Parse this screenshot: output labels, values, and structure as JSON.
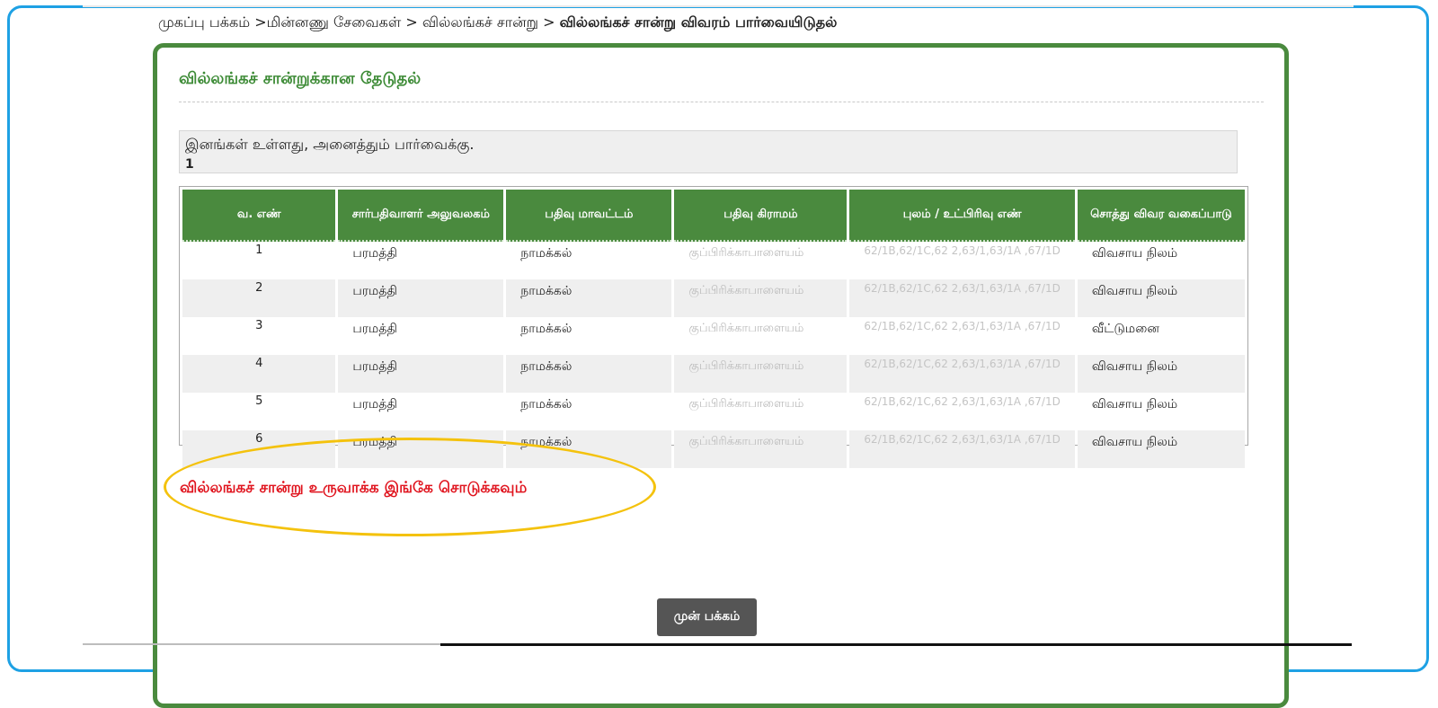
{
  "breadcrumb": {
    "home": "முகப்பு பக்கம்",
    "services": "மின்னணு சேவைகள்",
    "ec": "வில்லங்கச் சான்று",
    "current": "வில்லங்கச் சான்று விவரம் பார்வையிடுதல்",
    "separator": ">"
  },
  "panel": {
    "title": "வில்லங்கச் சான்றுக்கான தேடுதல்"
  },
  "result": {
    "message": "இனங்கள் உள்ளது, அனைத்தும் பார்வைக்கு.",
    "count": "1"
  },
  "table": {
    "headers": [
      "வ. எண்",
      "சார்பதிவாளர் அலுவலகம்",
      "பதிவு மாவட்டம்",
      "பதிவு கிராமம்",
      "புலம் / உட்பிரிவு எண்",
      "சொத்து விவர வகைப்பாடு"
    ],
    "rows": [
      {
        "sno": "1",
        "office": "பரமத்தி",
        "district": "நாமக்கல்",
        "village": "குப்பிரிக்காபாளையம்",
        "survey": "62/1B,62/1C,62 2,63/1,63/1A ,67/1D",
        "type": "விவசாய நிலம்"
      },
      {
        "sno": "2",
        "office": "பரமத்தி",
        "district": "நாமக்கல்",
        "village": "குப்பிரிக்காபாளையம்",
        "survey": "62/1B,62/1C,62 2,63/1,63/1A ,67/1D",
        "type": "விவசாய நிலம்"
      },
      {
        "sno": "3",
        "office": "பரமத்தி",
        "district": "நாமக்கல்",
        "village": "குப்பிரிக்காபாளையம்",
        "survey": "62/1B,62/1C,62 2,63/1,63/1A ,67/1D",
        "type": "வீட்டுமனை"
      },
      {
        "sno": "4",
        "office": "பரமத்தி",
        "district": "நாமக்கல்",
        "village": "குப்பிரிக்காபாளையம்",
        "survey": "62/1B,62/1C,62 2,63/1,63/1A ,67/1D",
        "type": "விவசாய நிலம்"
      },
      {
        "sno": "5",
        "office": "பரமத்தி",
        "district": "நாமக்கல்",
        "village": "குப்பிரிக்காபாளையம்",
        "survey": "62/1B,62/1C,62 2,63/1,63/1A ,67/1D",
        "type": "விவசாய நிலம்"
      },
      {
        "sno": "6",
        "office": "பரமத்தி",
        "district": "நாமக்கல்",
        "village": "குப்பிரிக்காபாளையம்",
        "survey": "62/1B,62/1C,62 2,63/1,63/1A ,67/1D",
        "type": "விவசாய நிலம்"
      }
    ]
  },
  "create_link": "வில்லங்கச் சான்று உருவாக்க இங்கே சொடுக்கவும்",
  "back_button": "முன் பக்கம்",
  "colors": {
    "frame": "#1ea1e4",
    "panel_border": "#4a8a3e",
    "header_bg": "#4a8a3e",
    "title": "#3d8b36",
    "link": "#e0141e",
    "highlight": "#f4c20d"
  }
}
